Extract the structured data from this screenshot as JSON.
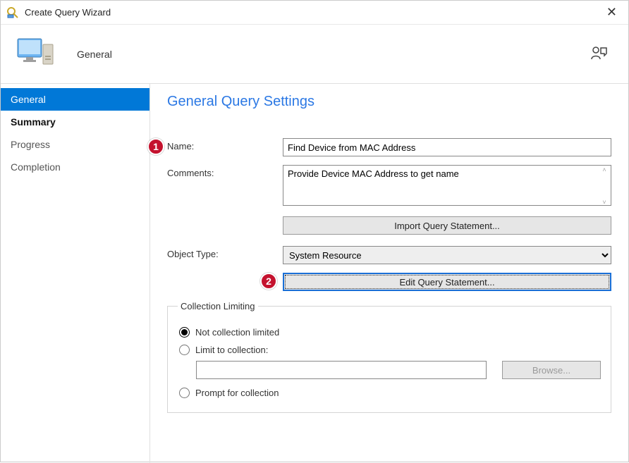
{
  "window": {
    "title": "Create Query Wizard"
  },
  "header": {
    "page_name": "General"
  },
  "sidebar": {
    "items": [
      {
        "label": "General",
        "active": true
      },
      {
        "label": "Summary"
      },
      {
        "label": "Progress"
      },
      {
        "label": "Completion"
      }
    ]
  },
  "main": {
    "section_title": "General Query Settings",
    "name_label": "Name:",
    "name_value": "Find Device from MAC Address",
    "comments_label": "Comments:",
    "comments_value": "Provide Device MAC Address to get name",
    "import_button": "Import Query Statement...",
    "object_type_label": "Object Type:",
    "object_type_value": "System Resource",
    "edit_button": "Edit Query Statement...",
    "collection": {
      "legend": "Collection Limiting",
      "not_limited": "Not collection limited",
      "limit_to": "Limit to collection:",
      "browse": "Browse...",
      "prompt": "Prompt for collection"
    }
  },
  "callouts": {
    "one": "1",
    "two": "2"
  }
}
